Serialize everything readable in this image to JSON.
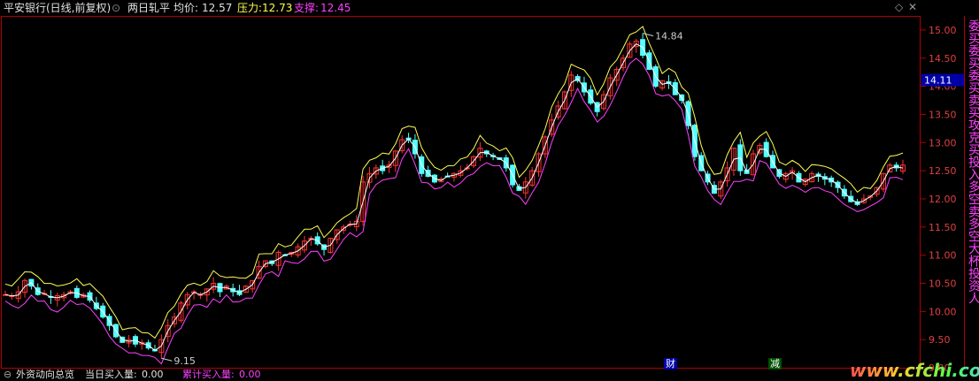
{
  "header": {
    "stock": "平安银行(日线,前复权)",
    "indicator": "两日轧平",
    "avg_label": "均价:",
    "avg_value": "12.57",
    "pressure_label": "压力:",
    "pressure_value": "12.73",
    "support_label": "支撑:",
    "support_value": "12.45"
  },
  "side_panel": {
    "text": "委买委买委买卖买攻克买投入多空卖多空大杯投资人"
  },
  "markers": {
    "cai": "财",
    "jian": "减"
  },
  "bottom": {
    "label1": "外资动向总览",
    "label2": "当日买入量:",
    "value2": "0.00",
    "label3": "累计买入量:",
    "value3": "0.00"
  },
  "watermark": "www.cfchi.com",
  "colors": {
    "bg": "#000000",
    "axis": "#b00000",
    "up": "#ff3232",
    "down": "#54ffff",
    "pressure": "#ffff50",
    "avg": "#ffffff",
    "support": "#ff40ff",
    "highlight": "#0000a8"
  },
  "chart_data": {
    "type": "candlestick",
    "y_axis_ticks": [
      "15.00",
      "14.50",
      "14.00",
      "13.50",
      "13.00",
      "12.50",
      "12.00",
      "11.50",
      "11.00",
      "10.50",
      "10.00",
      "9.50",
      "9.00"
    ],
    "ylim": [
      9.0,
      15.25
    ],
    "current_price_label": "14.11",
    "annotations": [
      {
        "text": "14.84",
        "price": 14.84
      },
      {
        "text": "9.15",
        "price": 9.15
      }
    ],
    "series": [
      {
        "name": "压力",
        "role": "pressure"
      },
      {
        "name": "均价",
        "role": "avg"
      },
      {
        "name": "支撑",
        "role": "support"
      }
    ],
    "close": [
      10.3,
      10.28,
      10.35,
      10.55,
      10.45,
      10.3,
      10.32,
      10.25,
      10.28,
      10.3,
      10.35,
      10.25,
      10.3,
      10.2,
      10.05,
      9.9,
      9.75,
      9.55,
      9.45,
      9.5,
      9.42,
      9.45,
      9.35,
      9.3,
      9.5,
      9.75,
      9.9,
      10.15,
      10.3,
      10.35,
      10.3,
      10.4,
      10.5,
      10.35,
      10.45,
      10.35,
      10.3,
      10.45,
      10.55,
      10.8,
      10.9,
      10.85,
      11.05,
      11.0,
      11.05,
      11.15,
      11.25,
      11.3,
      11.2,
      11.1,
      11.3,
      11.45,
      11.5,
      11.55,
      11.6,
      12.3,
      12.45,
      12.55,
      12.5,
      12.6,
      12.85,
      13.05,
      13.05,
      12.8,
      12.45,
      12.4,
      12.3,
      12.35,
      12.4,
      12.45,
      12.5,
      12.55,
      12.75,
      12.9,
      12.8,
      12.75,
      12.7,
      12.55,
      12.25,
      12.15,
      12.3,
      12.5,
      12.8,
      13.1,
      13.4,
      13.65,
      13.9,
      14.2,
      14.1,
      13.9,
      13.7,
      13.55,
      13.85,
      14.15,
      14.3,
      14.5,
      14.75,
      14.8,
      14.55,
      14.3,
      14.0,
      14.1,
      14.05,
      13.85,
      13.75,
      13.3,
      12.75,
      12.5,
      12.3,
      12.1,
      12.3,
      12.55,
      12.9,
      12.5,
      12.45,
      12.8,
      12.95,
      12.75,
      12.55,
      12.4,
      12.45,
      12.5,
      12.3,
      12.35,
      12.45,
      12.4,
      12.35,
      12.3,
      12.2,
      12.05,
      11.95,
      11.9,
      12.0,
      12.05,
      12.2,
      12.45,
      12.6,
      12.55,
      12.6
    ]
  }
}
